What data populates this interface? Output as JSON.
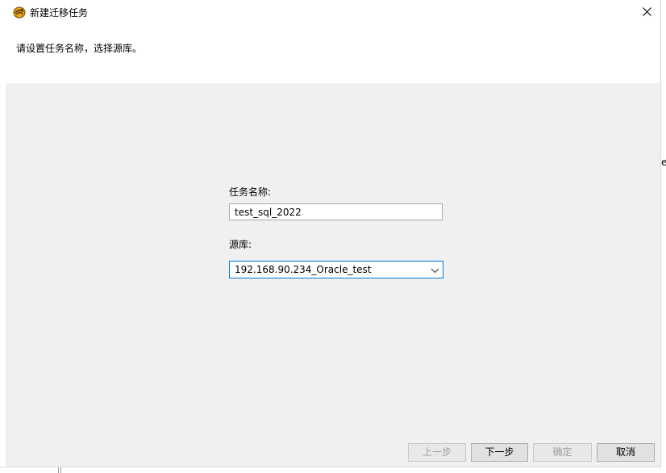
{
  "window": {
    "title": "新建迁移任务",
    "instruction": "请设置任务名称，选择源库。"
  },
  "form": {
    "task_name_label": "任务名称:",
    "task_name_value": "test_sql_2022",
    "source_label": "源库:",
    "source_value": "192.168.90.234_Oracle_test"
  },
  "buttons": {
    "prev": "上一步",
    "next": "下一步",
    "ok": "确定",
    "cancel": "取消"
  },
  "background": {
    "fragment_text": "eS"
  },
  "icons": {
    "app": "app-logo-icon",
    "close": "close-icon",
    "dropdown": "chevron-down-icon"
  },
  "colors": {
    "focus_border": "#0078d7",
    "dialog_body": "#f0f0f0",
    "disabled_text": "#a0a0a0"
  }
}
